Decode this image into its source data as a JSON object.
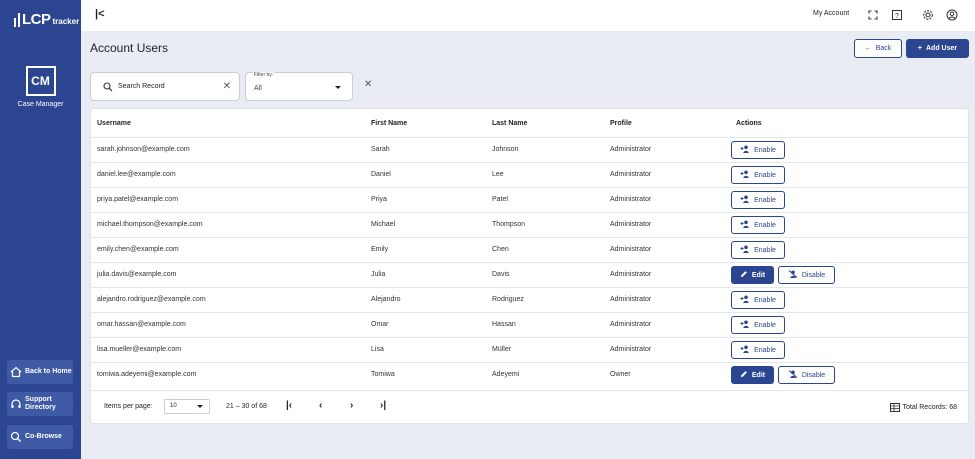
{
  "brand": {
    "logo_main": "LCP",
    "logo_sub": "tracker"
  },
  "module": {
    "abbr": "CM",
    "label": "Case Manager"
  },
  "sidebar": {
    "buttons": [
      {
        "label": "Back to Home",
        "icon": "home-icon"
      },
      {
        "label": "Support Directory",
        "icon": "headset-icon"
      },
      {
        "label": "Co-Browse",
        "icon": "cobrowse-icon"
      }
    ]
  },
  "header": {
    "collapse_glyph": "|<",
    "my_account": "My Account",
    "icons": [
      "fullscreen-icon",
      "help-icon",
      "settings-icon",
      "user-icon"
    ]
  },
  "page": {
    "title": "Account Users",
    "back_label": "Back",
    "add_user_label": "Add User"
  },
  "search": {
    "placeholder": "Search Record"
  },
  "filter": {
    "label": "Filter by:",
    "value": "All"
  },
  "table": {
    "columns": [
      "Username",
      "First Name",
      "Last Name",
      "Profile",
      "Actions"
    ],
    "rows": [
      {
        "username": "sarah.johnson@example.com",
        "first": "Sarah",
        "last": "Johnson",
        "profile": "Administrator",
        "actions": [
          "Enable"
        ]
      },
      {
        "username": "daniel.lee@example.com",
        "first": "Daniel",
        "last": "Lee",
        "profile": "Administrator",
        "actions": [
          "Enable"
        ]
      },
      {
        "username": "priya.patel@example.com",
        "first": "Priya",
        "last": "Patel",
        "profile": "Administrator",
        "actions": [
          "Enable"
        ]
      },
      {
        "username": "michael.thompson@example.com",
        "first": "Michael",
        "last": "Thompson",
        "profile": "Administrator",
        "actions": [
          "Enable"
        ]
      },
      {
        "username": "emily.chen@example.com",
        "first": "Emily",
        "last": "Chen",
        "profile": "Administrator",
        "actions": [
          "Enable"
        ]
      },
      {
        "username": "julia.davis@example.com",
        "first": "Julia",
        "last": "Davis",
        "profile": "Administrator",
        "actions": [
          "Edit",
          "Disable"
        ]
      },
      {
        "username": "alejandro.rodriguez@example.com",
        "first": "Alejandro",
        "last": "Rodriguez",
        "profile": "Administrator",
        "actions": [
          "Enable"
        ]
      },
      {
        "username": "omar.hassan@example.com",
        "first": "Omar",
        "last": "Hassan",
        "profile": "Administrator",
        "actions": [
          "Enable"
        ]
      },
      {
        "username": "lisa.mueller@example.com",
        "first": "Lisa",
        "last": "Müller",
        "profile": "Administrator",
        "actions": [
          "Enable"
        ]
      },
      {
        "username": "tomiwa.adeyemi@example.com",
        "first": "Tomiwa",
        "last": "Adeyemi",
        "profile": "Owner",
        "actions": [
          "Edit",
          "Disable"
        ]
      }
    ]
  },
  "pagination": {
    "items_per_page_label": "Items per page:",
    "items_per_page_value": "10",
    "range": "21 – 30 of 68",
    "total_records": "Total Records: 68"
  },
  "colors": {
    "primary": "#2c4590",
    "sidebar": "#2c4590",
    "background": "#e9ecf2"
  }
}
